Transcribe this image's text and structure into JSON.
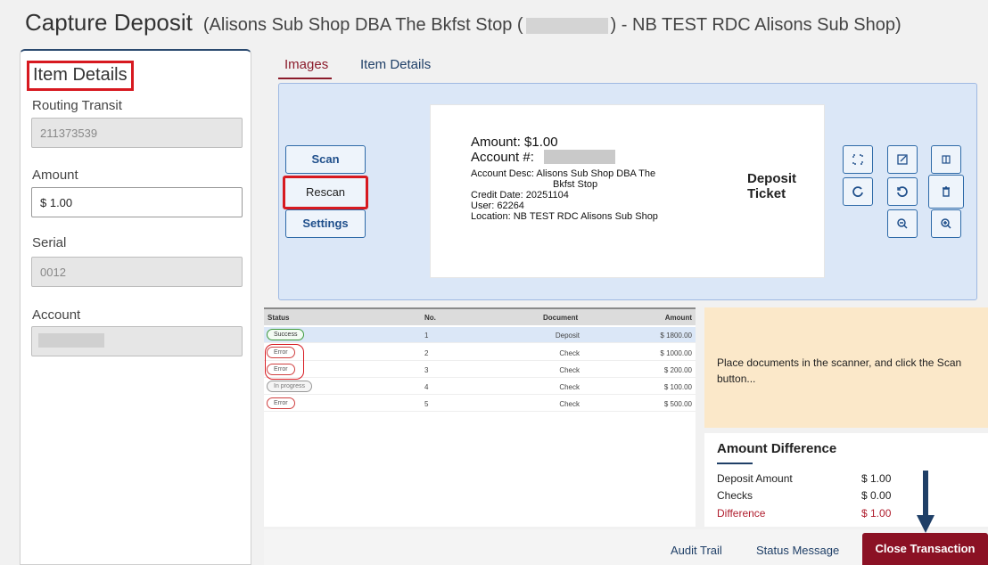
{
  "header": {
    "title": "Capture Deposit",
    "subtitle_prefix": "(Alisons Sub Shop DBA The Bkfst Stop (",
    "subtitle_suffix": ") - NB TEST RDC Alisons Sub Shop)"
  },
  "left_panel": {
    "title": "Item Details",
    "routing_label": "Routing Transit",
    "routing_value": "211373539",
    "amount_label": "Amount",
    "amount_value": "$ 1.00",
    "serial_label": "Serial",
    "serial_value": "0012",
    "account_label": "Account"
  },
  "tabs": [
    {
      "label": "Images",
      "active": true
    },
    {
      "label": "Item Details",
      "active": false
    }
  ],
  "scan_buttons": {
    "scan": "Scan",
    "rescan": "Rescan",
    "settings": "Settings"
  },
  "ticket": {
    "amount": "Amount: $1.00",
    "account": "Account #:",
    "desc_line1": "Account Desc: Alisons Sub Shop DBA The",
    "desc_line2": "Bkfst Stop",
    "credit_date": "Credit Date: 20251104",
    "user": "User: 62264",
    "location": "Location: NB TEST RDC Alisons Sub Shop",
    "deposit_line1": "Deposit",
    "deposit_line2": "Ticket"
  },
  "image_tools": [
    "expand-icon",
    "open-external-icon",
    "compare-icon",
    "rotate-right-icon",
    "rotate-left-icon",
    "delete-icon",
    "zoom-out-icon",
    "zoom-in-icon"
  ],
  "table": {
    "headers": {
      "status": "Status",
      "no": "No.",
      "document": "Document",
      "amount": "Amount"
    },
    "rows": [
      {
        "status": "Success",
        "no": "1",
        "document": "Deposit",
        "amount": "$ 1800.00"
      },
      {
        "status": "Error",
        "no": "2",
        "document": "Check",
        "amount": "$ 1000.00"
      },
      {
        "status": "Error",
        "no": "3",
        "document": "Check",
        "amount": "$ 200.00"
      },
      {
        "status": "In progress",
        "no": "4",
        "document": "Check",
        "amount": "$ 100.00"
      },
      {
        "status": "Error",
        "no": "5",
        "document": "Check",
        "amount": "$ 500.00"
      }
    ]
  },
  "message": "Place documents in the scanner, and click the Scan button...",
  "amount_difference": {
    "title": "Amount Difference",
    "deposit_label": "Deposit Amount",
    "deposit_value": "$ 1.00",
    "checks_label": "Checks",
    "checks_value": "$ 0.00",
    "difference_label": "Difference",
    "difference_value": "$ 1.00"
  },
  "footer": {
    "audit_trail": "Audit Trail",
    "status_message": "Status Message",
    "close_transaction": "Close Transaction"
  },
  "colors": {
    "accent": "#8b1124",
    "highlight_red": "#d71920",
    "link_blue": "#1f3f67"
  }
}
